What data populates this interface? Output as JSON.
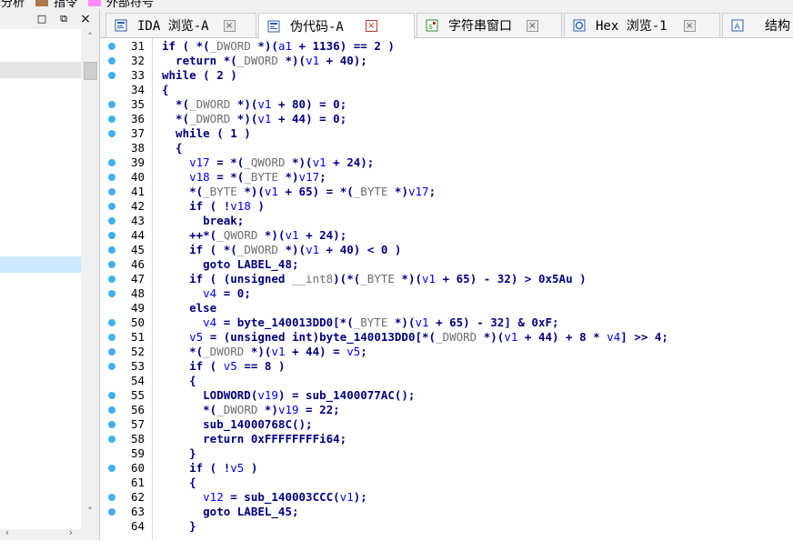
{
  "legend": [
    {
      "label": "未分析",
      "color": ""
    },
    {
      "label": "指令",
      "color": "#b0784a"
    },
    {
      "label": "外部符号",
      "color": "#ff8cff"
    }
  ],
  "left_panel": {
    "restore_icon": "□",
    "float_icon": "⧉",
    "close_icon": "×",
    "scroll_up": "˄",
    "scroll_down": "˅",
    "scroll_left": "‹",
    "scroll_right": "›"
  },
  "tabs": [
    {
      "label": "IDA 浏览-A",
      "icon": "ida-view-icon",
      "active": false,
      "closable": true
    },
    {
      "label": "伪代码-A",
      "icon": "pseudocode-icon",
      "active": true,
      "closable": true
    },
    {
      "label": "字符串窗口",
      "icon": "strings-icon",
      "active": false,
      "closable": true
    },
    {
      "label": "Hex 浏览-1",
      "icon": "hex-view-icon",
      "active": false,
      "closable": true
    },
    {
      "label": "结构",
      "icon": "structures-icon",
      "active": false,
      "closable": false
    }
  ],
  "tab_close_glyph": "×",
  "colors": {
    "keyword": "#000080",
    "variable": "#0000ff",
    "type_cast": "#6e6e6e",
    "breakpoint_dot": "#3fb1f0"
  },
  "code_lines": [
    {
      "n": "31",
      "dot": true,
      "segs": [
        [
          "k",
          "if ( *("
        ],
        [
          "t",
          "_DWORD"
        ],
        [
          "k",
          " *)("
        ],
        [
          "v",
          "a1"
        ],
        [
          "k",
          " + 1136) == 2 )"
        ]
      ]
    },
    {
      "n": "32",
      "dot": true,
      "segs": [
        [
          "k",
          "  return *("
        ],
        [
          "t",
          "_DWORD"
        ],
        [
          "k",
          " *)("
        ],
        [
          "v",
          "v1"
        ],
        [
          "k",
          " + 40);"
        ]
      ]
    },
    {
      "n": "33",
      "dot": true,
      "segs": [
        [
          "k",
          "while ( 2 )"
        ]
      ]
    },
    {
      "n": "34",
      "dot": false,
      "segs": [
        [
          "k",
          "{"
        ]
      ]
    },
    {
      "n": "35",
      "dot": true,
      "segs": [
        [
          "k",
          "  *("
        ],
        [
          "t",
          "_DWORD"
        ],
        [
          "k",
          " *)("
        ],
        [
          "v",
          "v1"
        ],
        [
          "k",
          " + 80) = 0;"
        ]
      ]
    },
    {
      "n": "36",
      "dot": true,
      "segs": [
        [
          "k",
          "  *("
        ],
        [
          "t",
          "_DWORD"
        ],
        [
          "k",
          " *)("
        ],
        [
          "v",
          "v1"
        ],
        [
          "k",
          " + 44) = 0;"
        ]
      ]
    },
    {
      "n": "37",
      "dot": true,
      "segs": [
        [
          "k",
          "  while ( 1 )"
        ]
      ]
    },
    {
      "n": "38",
      "dot": false,
      "segs": [
        [
          "k",
          "  {"
        ]
      ]
    },
    {
      "n": "39",
      "dot": true,
      "segs": [
        [
          "k",
          "    "
        ],
        [
          "v",
          "v17"
        ],
        [
          "k",
          " = *("
        ],
        [
          "t",
          "_QWORD"
        ],
        [
          "k",
          " *)("
        ],
        [
          "v",
          "v1"
        ],
        [
          "k",
          " + 24);"
        ]
      ]
    },
    {
      "n": "40",
      "dot": true,
      "segs": [
        [
          "k",
          "    "
        ],
        [
          "v",
          "v18"
        ],
        [
          "k",
          " = *("
        ],
        [
          "t",
          "_BYTE"
        ],
        [
          "k",
          " *)"
        ],
        [
          "v",
          "v17"
        ],
        [
          "k",
          ";"
        ]
      ]
    },
    {
      "n": "41",
      "dot": true,
      "segs": [
        [
          "k",
          "    *("
        ],
        [
          "t",
          "_BYTE"
        ],
        [
          "k",
          " *)("
        ],
        [
          "v",
          "v1"
        ],
        [
          "k",
          " + 65) = *("
        ],
        [
          "t",
          "_BYTE"
        ],
        [
          "k",
          " *)"
        ],
        [
          "v",
          "v17"
        ],
        [
          "k",
          ";"
        ]
      ]
    },
    {
      "n": "42",
      "dot": true,
      "segs": [
        [
          "k",
          "    if ( !"
        ],
        [
          "v",
          "v18"
        ],
        [
          "k",
          " )"
        ]
      ]
    },
    {
      "n": "43",
      "dot": true,
      "segs": [
        [
          "k",
          "      break;"
        ]
      ]
    },
    {
      "n": "44",
      "dot": true,
      "segs": [
        [
          "k",
          "    ++*("
        ],
        [
          "t",
          "_QWORD"
        ],
        [
          "k",
          " *)("
        ],
        [
          "v",
          "v1"
        ],
        [
          "k",
          " + 24);"
        ]
      ]
    },
    {
      "n": "45",
      "dot": true,
      "segs": [
        [
          "k",
          "    if ( *("
        ],
        [
          "t",
          "_DWORD"
        ],
        [
          "k",
          " *)("
        ],
        [
          "v",
          "v1"
        ],
        [
          "k",
          " + 40) < 0 )"
        ]
      ]
    },
    {
      "n": "46",
      "dot": true,
      "segs": [
        [
          "k",
          "      goto LABEL_48;"
        ]
      ]
    },
    {
      "n": "47",
      "dot": true,
      "segs": [
        [
          "k",
          "    if ( (unsigned "
        ],
        [
          "t",
          "__int8"
        ],
        [
          "k",
          ")(*("
        ],
        [
          "t",
          "_BYTE"
        ],
        [
          "k",
          " *)("
        ],
        [
          "v",
          "v1"
        ],
        [
          "k",
          " + 65) - 32) > 0x5Au )"
        ]
      ]
    },
    {
      "n": "48",
      "dot": true,
      "segs": [
        [
          "k",
          "      "
        ],
        [
          "v",
          "v4"
        ],
        [
          "k",
          " = 0;"
        ]
      ]
    },
    {
      "n": "49",
      "dot": false,
      "segs": [
        [
          "k",
          "    else"
        ]
      ]
    },
    {
      "n": "50",
      "dot": true,
      "segs": [
        [
          "k",
          "      "
        ],
        [
          "v",
          "v4"
        ],
        [
          "k",
          " = byte_140013DD0[*("
        ],
        [
          "t",
          "_BYTE"
        ],
        [
          "k",
          " *)("
        ],
        [
          "v",
          "v1"
        ],
        [
          "k",
          " + 65) - 32] & 0xF;"
        ]
      ]
    },
    {
      "n": "51",
      "dot": true,
      "segs": [
        [
          "k",
          "    "
        ],
        [
          "v",
          "v5"
        ],
        [
          "k",
          " = (unsigned int)byte_140013DD0[*("
        ],
        [
          "t",
          "_DWORD"
        ],
        [
          "k",
          " *)("
        ],
        [
          "v",
          "v1"
        ],
        [
          "k",
          " + 44) + 8 * "
        ],
        [
          "v",
          "v4"
        ],
        [
          "k",
          "] >> 4;"
        ]
      ]
    },
    {
      "n": "52",
      "dot": true,
      "segs": [
        [
          "k",
          "    *("
        ],
        [
          "t",
          "_DWORD"
        ],
        [
          "k",
          " *)("
        ],
        [
          "v",
          "v1"
        ],
        [
          "k",
          " + 44) = "
        ],
        [
          "v",
          "v5"
        ],
        [
          "k",
          ";"
        ]
      ]
    },
    {
      "n": "53",
      "dot": true,
      "segs": [
        [
          "k",
          "    if ( "
        ],
        [
          "v",
          "v5"
        ],
        [
          "k",
          " == 8 )"
        ]
      ]
    },
    {
      "n": "54",
      "dot": false,
      "segs": [
        [
          "k",
          "    {"
        ]
      ]
    },
    {
      "n": "55",
      "dot": true,
      "segs": [
        [
          "k",
          "      LODWORD("
        ],
        [
          "v",
          "v19"
        ],
        [
          "k",
          ") = sub_1400077AC();"
        ]
      ]
    },
    {
      "n": "56",
      "dot": true,
      "segs": [
        [
          "k",
          "      *("
        ],
        [
          "t",
          "_DWORD"
        ],
        [
          "k",
          " *)"
        ],
        [
          "v",
          "v19"
        ],
        [
          "k",
          " = 22;"
        ]
      ]
    },
    {
      "n": "57",
      "dot": true,
      "segs": [
        [
          "k",
          "      sub_14000768C();"
        ]
      ]
    },
    {
      "n": "58",
      "dot": true,
      "segs": [
        [
          "k",
          "      return 0xFFFFFFFFi64;"
        ]
      ]
    },
    {
      "n": "59",
      "dot": false,
      "segs": [
        [
          "k",
          "    }"
        ]
      ]
    },
    {
      "n": "60",
      "dot": true,
      "segs": [
        [
          "k",
          "    if ( !"
        ],
        [
          "v",
          "v5"
        ],
        [
          "k",
          " )"
        ]
      ]
    },
    {
      "n": "61",
      "dot": false,
      "segs": [
        [
          "k",
          "    {"
        ]
      ]
    },
    {
      "n": "62",
      "dot": true,
      "segs": [
        [
          "k",
          "      "
        ],
        [
          "v",
          "v12"
        ],
        [
          "k",
          " = sub_140003CCC("
        ],
        [
          "v",
          "v1"
        ],
        [
          "k",
          ");"
        ]
      ]
    },
    {
      "n": "63",
      "dot": true,
      "segs": [
        [
          "k",
          "      goto LABEL_45;"
        ]
      ]
    },
    {
      "n": "64",
      "dot": false,
      "segs": [
        [
          "k",
          "    }"
        ]
      ]
    }
  ]
}
